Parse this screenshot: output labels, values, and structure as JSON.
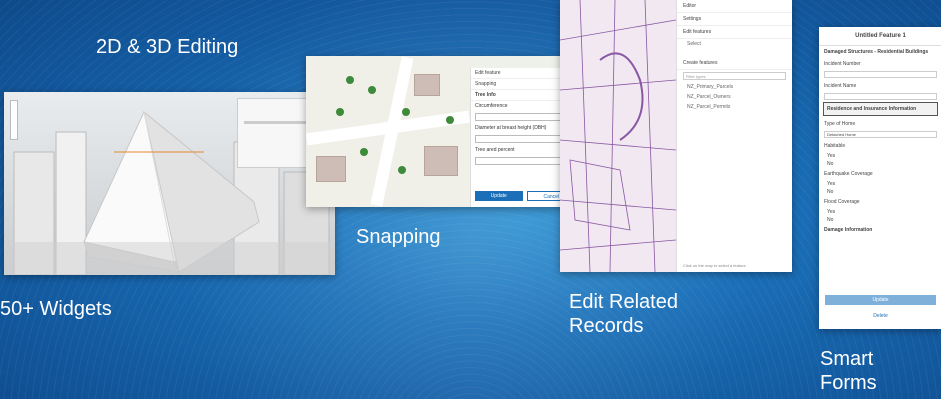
{
  "captions": {
    "editing": "2D & 3D Editing",
    "widgets": "50+ Widgets",
    "snapping": "Snapping",
    "edit_related_line1": "Edit Related",
    "edit_related_line2": "Records",
    "smart_line1": "Smart",
    "smart_line2": "Forms"
  },
  "snapping_panel": {
    "header": "Edit feature",
    "snapping_label": "Snapping",
    "section": "Tree Info",
    "field1": "Circumference",
    "field2": "Diameter at breast height (DBH)",
    "field3": "Tree ared percent",
    "update_label": "Update",
    "cancel_label": "Cancel"
  },
  "editor_panel": {
    "title": "Editor",
    "settings_label": "Settings",
    "edit_features": "Edit features",
    "select_label": "Select",
    "create_features": "Create features",
    "filter_placeholder": "Filter types",
    "layers": [
      "NZ_Primary_Parcels",
      "NZ_Parcel_Owners",
      "NZ_Parcel_Permits"
    ],
    "footer": "Click on the map to select a feature."
  },
  "smart_form": {
    "title": "Untitled Feature 1",
    "group": "Damaged Structures - Residential Buildings",
    "field_number": "Incident Number",
    "field_name": "Incident Name",
    "section": "Residence and Insurance Information",
    "type_label": "Type of Home",
    "type_value": "Detached Home",
    "habitable": "Habitable",
    "earthquake": "Earthquake Coverage",
    "flood": "Flood Coverage",
    "yes": "Yes",
    "no": "No",
    "damage": "Damage Information",
    "update_label": "Update",
    "delete_label": "Delete"
  },
  "colors": {
    "background": "#1a6fb8",
    "accent": "#1a6fb8",
    "parcel_lines": "#6a2d8a"
  }
}
